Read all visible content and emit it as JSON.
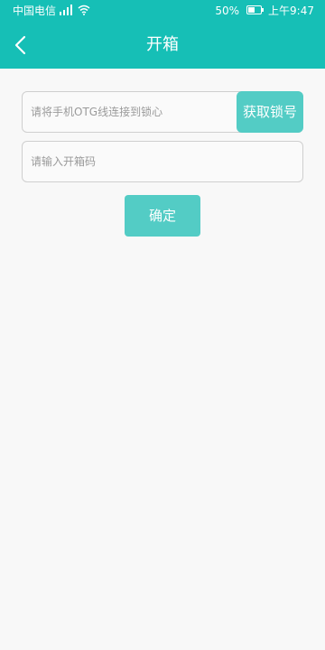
{
  "status_bar": {
    "carrier": "中国电信",
    "battery_percent": "50%",
    "time": "上午9:47",
    "icons": [
      "signal-icon",
      "wifi-icon",
      "battery-icon"
    ]
  },
  "header": {
    "title": "开箱",
    "back_icon": "back-arrow-icon"
  },
  "form": {
    "lock_field": {
      "placeholder": "请将手机OTG线连接到锁心",
      "value": "",
      "button_label": "获取锁号"
    },
    "code_field": {
      "placeholder": "请输入开箱码",
      "value": ""
    },
    "confirm_label": "确定"
  },
  "colors": {
    "primary": "#16bfb6",
    "button": "#53ccc5",
    "background": "#f8f8f8",
    "border": "#cfcfcf",
    "placeholder": "#9a9a9a"
  }
}
